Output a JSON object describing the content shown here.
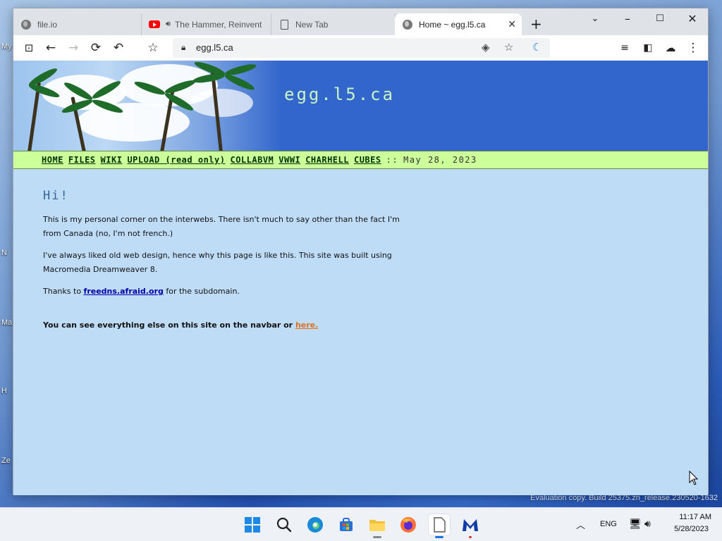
{
  "browser": {
    "tabs": [
      {
        "title": "file.io",
        "icon": "globe-icon",
        "active": false
      },
      {
        "title": "The Hammer, Reinvent",
        "icon": "youtube-icon",
        "active": false
      },
      {
        "title": "New Tab",
        "icon": "page-icon",
        "active": false
      },
      {
        "title": "Home ~ egg.l5.ca",
        "icon": "globe-icon",
        "active": true
      }
    ],
    "address": {
      "url": "egg.l5.ca"
    }
  },
  "page": {
    "site_title": "egg.l5.ca",
    "nav": {
      "items": [
        "HOME",
        "FILES",
        "WIKI",
        "UPLOAD (read only)",
        "COLLABVM",
        "VWWI",
        "CHARHELL",
        "CUBES"
      ],
      "separator": "::",
      "date": "May 28, 2023"
    },
    "heading": "Hi!",
    "para1": "This is my personal corner on the interwebs. There isn't much to say other than the fact I'm from Canada (no, I'm not french.)",
    "para2": "I've always liked old web design, hence why this page is like this. This site was built using Macromedia Dreamweaver 8.",
    "para3_prefix": "Thanks to",
    "para3_link": "freedns.afraid.org",
    "para3_suffix": "for the subdomain.",
    "final_prefix": "You can see everything else on this site on the navbar or",
    "final_link": "here."
  },
  "desktop": {
    "eval_text": "Evaluation copy. Build 25375.zn_release.230520-1632",
    "icon_labels": [
      "My",
      "N",
      "Ma",
      "H",
      "Ze"
    ]
  },
  "taskbar": {
    "language": "ENG",
    "time": "11:17 AM",
    "date": "5/28/2023"
  },
  "colors": {
    "banner_blue": "#3366cc",
    "navbar_green": "#ccff99",
    "page_bg": "#bfdcf7",
    "title_green": "#c8f5c0",
    "link_orange": "#e07020"
  }
}
